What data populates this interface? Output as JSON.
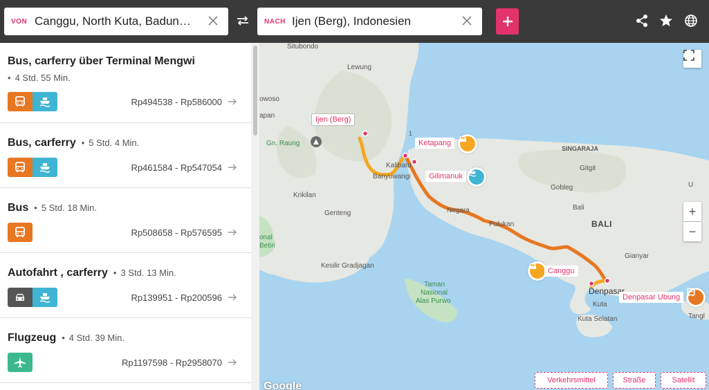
{
  "header": {
    "from_tag": "VON",
    "from_value": "Canggu, North Kuta, Badung...",
    "to_tag": "NACH",
    "to_value": "Ijen (Berg), Indonesien"
  },
  "routes": [
    {
      "title": "Bus, carferry über Terminal Mengwi",
      "duration": "4 Std. 55 Min.",
      "price": "Rp494538 - Rp586000",
      "modes": [
        "bus-icon",
        "ferry-icon"
      ]
    },
    {
      "title": "Bus, carferry",
      "duration": "5 Std. 4 Min.",
      "price": "Rp461584 - Rp547054",
      "modes": [
        "bus-icon",
        "ferry-icon"
      ]
    },
    {
      "title": "Bus",
      "duration": "5 Std. 18 Min.",
      "price": "Rp508658 - Rp576595",
      "modes": [
        "bus-icon"
      ]
    },
    {
      "title": "Autofahrt , carferry",
      "duration": "3 Std. 13 Min.",
      "price": "Rp139951 - Rp200596",
      "modes": [
        "car-icon",
        "ferry-icon"
      ]
    },
    {
      "title": "Flugzeug",
      "duration": "4 Std. 39 Min.",
      "price": "Rp1197598 - Rp2958070",
      "modes": [
        "plane-icon"
      ]
    }
  ],
  "colors": {
    "accent": "#e2336b",
    "bus": "#e87722",
    "ferry": "#3fb5d3",
    "car": "#555555",
    "plane": "#3cb88f",
    "route_orange": "#e87722",
    "route_yellow": "#f5a623"
  },
  "map": {
    "labels": {
      "situbondo": "Situbondo",
      "lewung": "Lewung",
      "wowoso": "owoso",
      "japan": "apan",
      "gn_raung": "Gn. Raung",
      "krikilan": "Krikilan",
      "genteng": "Genteng",
      "kalibaru": "Kalibaru",
      "banyuwangi": "Banyuwangi",
      "singaraja": "SINGARAJA",
      "gitgit": "Gitgit",
      "gobleg": "Gobleg",
      "bali": "Bali",
      "bali_region": "BALI",
      "negara": "Negara",
      "pulukan": "Pulukan",
      "gianyar": "Gianyar",
      "denpasar": "Denpasar",
      "kuta": "Kuta",
      "kuta_selatan": "Kuta Selatan",
      "tangl": "Tangl",
      "kesilir": "Kesilir Gradjagan",
      "taman": "Taman",
      "nasional": "Nasional",
      "alas_purwo": "Alas Purwo",
      "betiri_a": "onal",
      "betiri_b": "Betiri",
      "tian": "tian",
      "ubud_a": "U",
      "road1": "1"
    },
    "places": {
      "ijen": "Ijen (Berg)",
      "ketapang": "Ketapang",
      "gilimanuk": "Gilimanuk",
      "canggu": "Canggu",
      "denpasar_ubung": "Denpasar Ubung"
    },
    "layers": {
      "traffic": "Verkehrsmittel",
      "road": "Straße",
      "satellite": "Satellit"
    },
    "zoom_in": "+",
    "zoom_out": "−",
    "google": "Google"
  }
}
